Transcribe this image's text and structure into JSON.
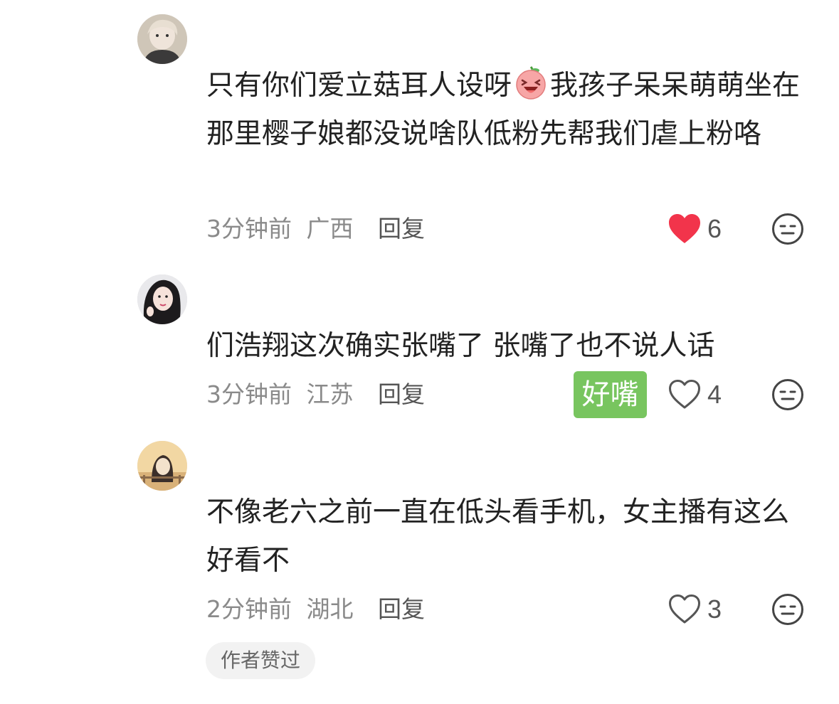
{
  "comments": [
    {
      "text_before_emoji": "只有你们爱立菇耳人设呀",
      "emoji": "laughing-peach-emoji",
      "text_after_emoji": "我孩子呆呆萌萌坐在那里樱子娘都没说啥队低粉先帮我们虐上粉咯",
      "time": "3分钟前",
      "location": "广西",
      "reply_label": "回复",
      "likes": "6",
      "liked": true
    },
    {
      "text": "们浩翔这次确实张嘴了 张嘴了也不说人话",
      "sticker_text": "好嘴",
      "time": "3分钟前",
      "location": "江苏",
      "reply_label": "回复",
      "likes": "4",
      "liked": false
    },
    {
      "text": "不像老六之前一直在低头看手机，女主播有这么好看不",
      "time": "2分钟前",
      "location": "湖北",
      "reply_label": "回复",
      "likes": "3",
      "liked": false,
      "badge": "作者赞过"
    }
  ],
  "colors": {
    "like_active": "#f2344b",
    "sticker_bg": "#78c55f",
    "meta_text": "#8a8a8a"
  }
}
